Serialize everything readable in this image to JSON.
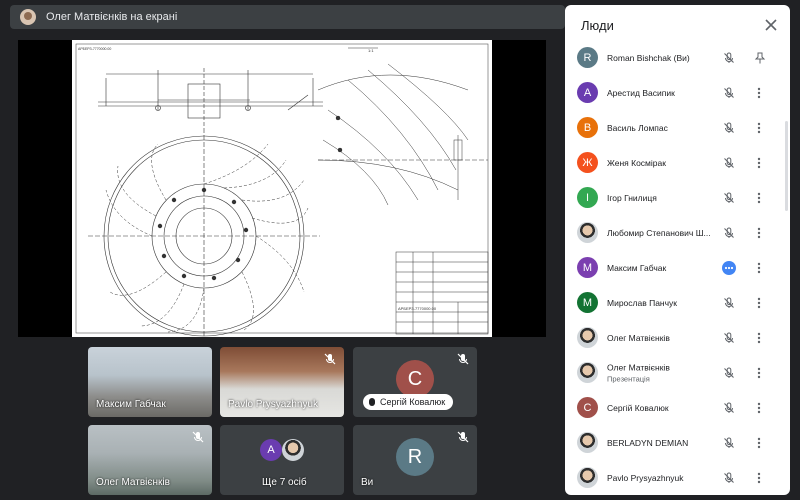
{
  "topbar": {
    "presenter_text": "Олег Матвієнків на екрані"
  },
  "screen": {
    "drawing_title_small": "АРБЕРЗ-7770000.00",
    "drawing_code": "АРБЕРЗ-7770000.00",
    "view_label": "1:1"
  },
  "tiles": [
    {
      "name": "Максим Габчак",
      "muted": false
    },
    {
      "name": "Pavlo Prysyazhnyuk",
      "muted": true
    },
    {
      "name": "Сергій Ковалюк",
      "initial": "С",
      "color": "#a0504a",
      "muted": true
    },
    {
      "name": "Олег Матвієнків",
      "muted": true
    },
    {
      "name": "Ще 7 осіб",
      "initial": "А",
      "color": "#6a3cb0"
    },
    {
      "name": "Ви",
      "initial": "R",
      "color": "#5b7a86",
      "muted": true
    }
  ],
  "panel": {
    "title": "Люди",
    "people": [
      {
        "name": "Roman Bishchak (Ви)",
        "initial": "R",
        "color": "#5b7a86",
        "sub": ""
      },
      {
        "name": "Арестид Васипик",
        "initial": "А",
        "color": "#6a3cb0",
        "sub": ""
      },
      {
        "name": "Василь Ломпас",
        "initial": "В",
        "color": "#e8710a",
        "sub": ""
      },
      {
        "name": "Женя Космірак",
        "initial": "Ж",
        "color": "#f4511e",
        "sub": ""
      },
      {
        "name": "Ігор Гнилиця",
        "initial": "І",
        "color": "#33a852",
        "sub": ""
      },
      {
        "name": "Любомир Степанович Ш...",
        "initial": "",
        "color": "#9aa0a6",
        "sub": ""
      },
      {
        "name": "Максим Габчак",
        "initial": "М",
        "color": "#7b3fb0",
        "sub": ""
      },
      {
        "name": "Мирослав Панчук",
        "initial": "М",
        "color": "#137333",
        "sub": ""
      },
      {
        "name": "Олег Матвієнків",
        "initial": "",
        "color": "#9aa0a6",
        "sub": ""
      },
      {
        "name": "Олег Матвієнків",
        "initial": "",
        "color": "#9aa0a6",
        "sub": "Презентація"
      },
      {
        "name": "Сергій Ковалюк",
        "initial": "С",
        "color": "#a0504a",
        "sub": ""
      },
      {
        "name": "BERLADYN DEMIAN",
        "initial": "",
        "color": "#9aa0a6",
        "sub": ""
      },
      {
        "name": "Pavlo Prysyazhnyuk",
        "initial": "",
        "color": "#9aa0a6",
        "sub": ""
      }
    ]
  },
  "icons": [
    "mic-off-icon",
    "more-vert-icon",
    "pin-icon",
    "close-icon",
    "more-horiz-icon"
  ]
}
